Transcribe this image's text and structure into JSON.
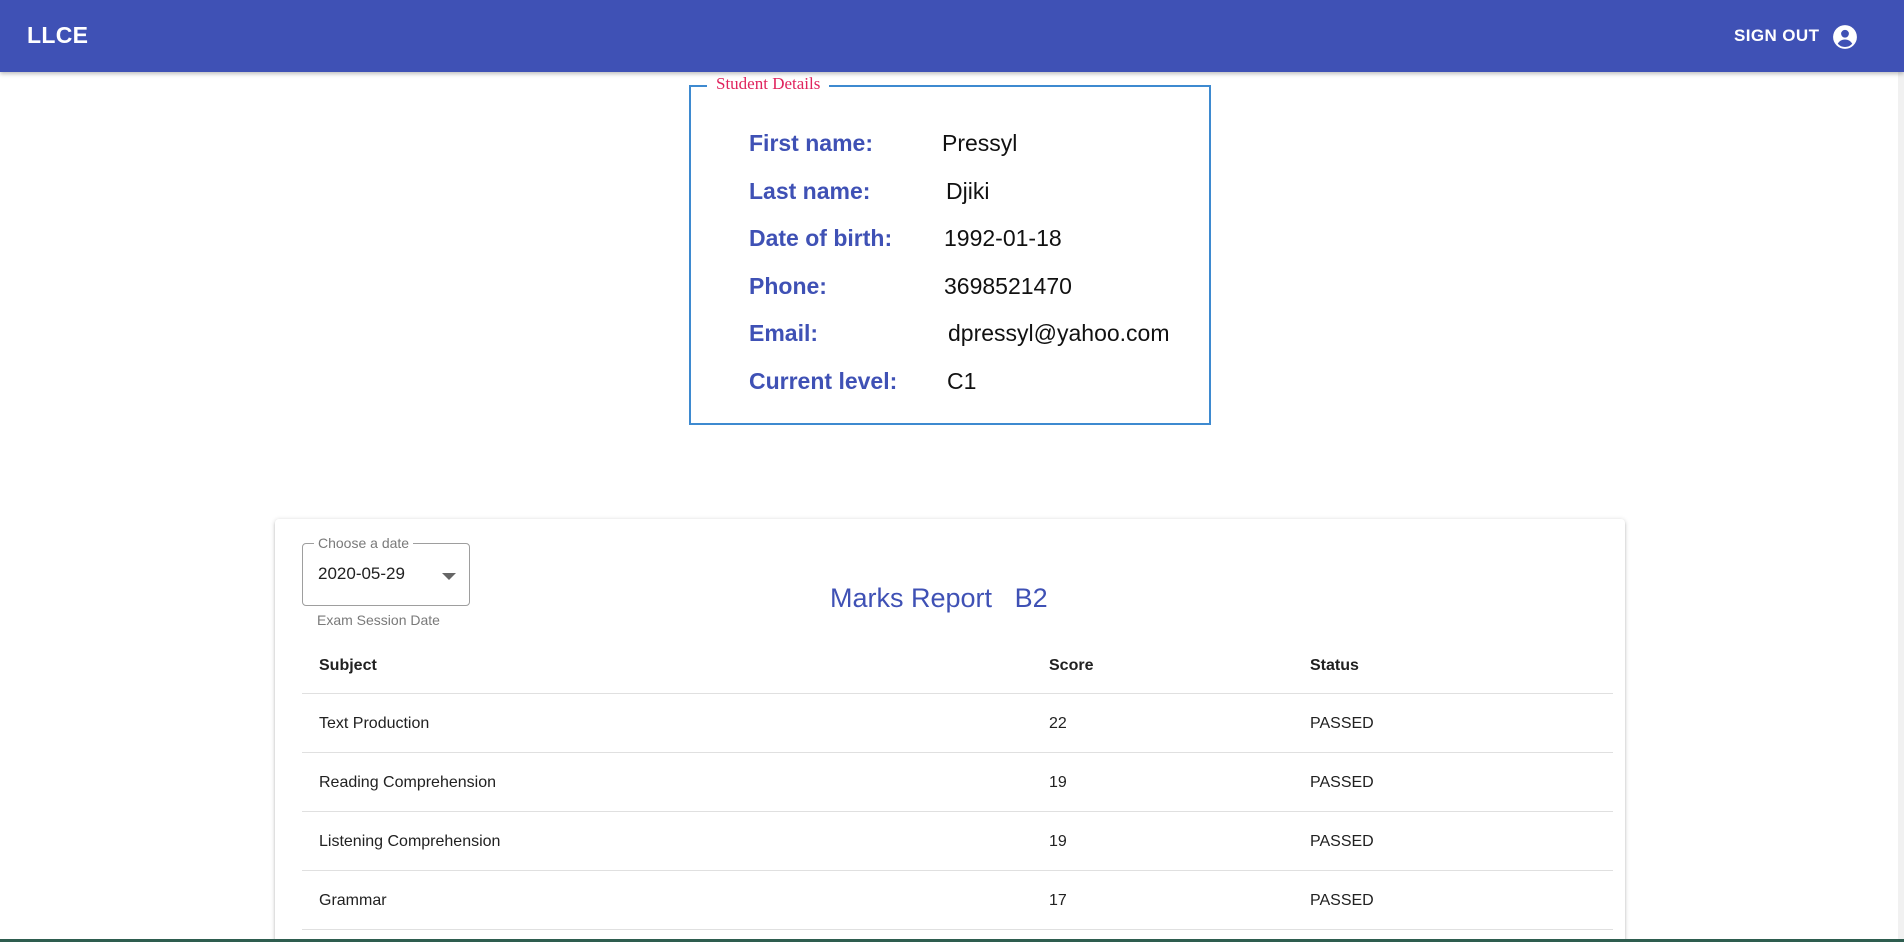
{
  "appbar": {
    "brand": "LLCE",
    "signout_label": "SIGN OUT",
    "account_icon": "account-circle-icon",
    "color": "#3f51b5"
  },
  "student_details": {
    "legend": "Student Details",
    "fields": [
      {
        "label": "First name:",
        "value": "Pressyl"
      },
      {
        "label": "Last name:",
        "value": "Djiki"
      },
      {
        "label": "Date of birth:",
        "value": "1992-01-18"
      },
      {
        "label": "Phone:",
        "value": "3698521470"
      },
      {
        "label": "Email:",
        "value": "dpressyl@yahoo.com"
      },
      {
        "label": "Current level:",
        "value": "C1"
      }
    ]
  },
  "report": {
    "date_select": {
      "label": "Choose a date",
      "value": "2020-05-29",
      "hint": "Exam Session Date"
    },
    "title": "Marks Report",
    "level": "B2",
    "columns": [
      "Subject",
      "Score",
      "Status"
    ],
    "rows": [
      {
        "subject": "Text Production",
        "score": "22",
        "status": "PASSED"
      },
      {
        "subject": "Reading Comprehension",
        "score": "19",
        "status": "PASSED"
      },
      {
        "subject": "Listening Comprehension",
        "score": "19",
        "status": "PASSED"
      },
      {
        "subject": "Grammar",
        "score": "17",
        "status": "PASSED"
      }
    ]
  }
}
